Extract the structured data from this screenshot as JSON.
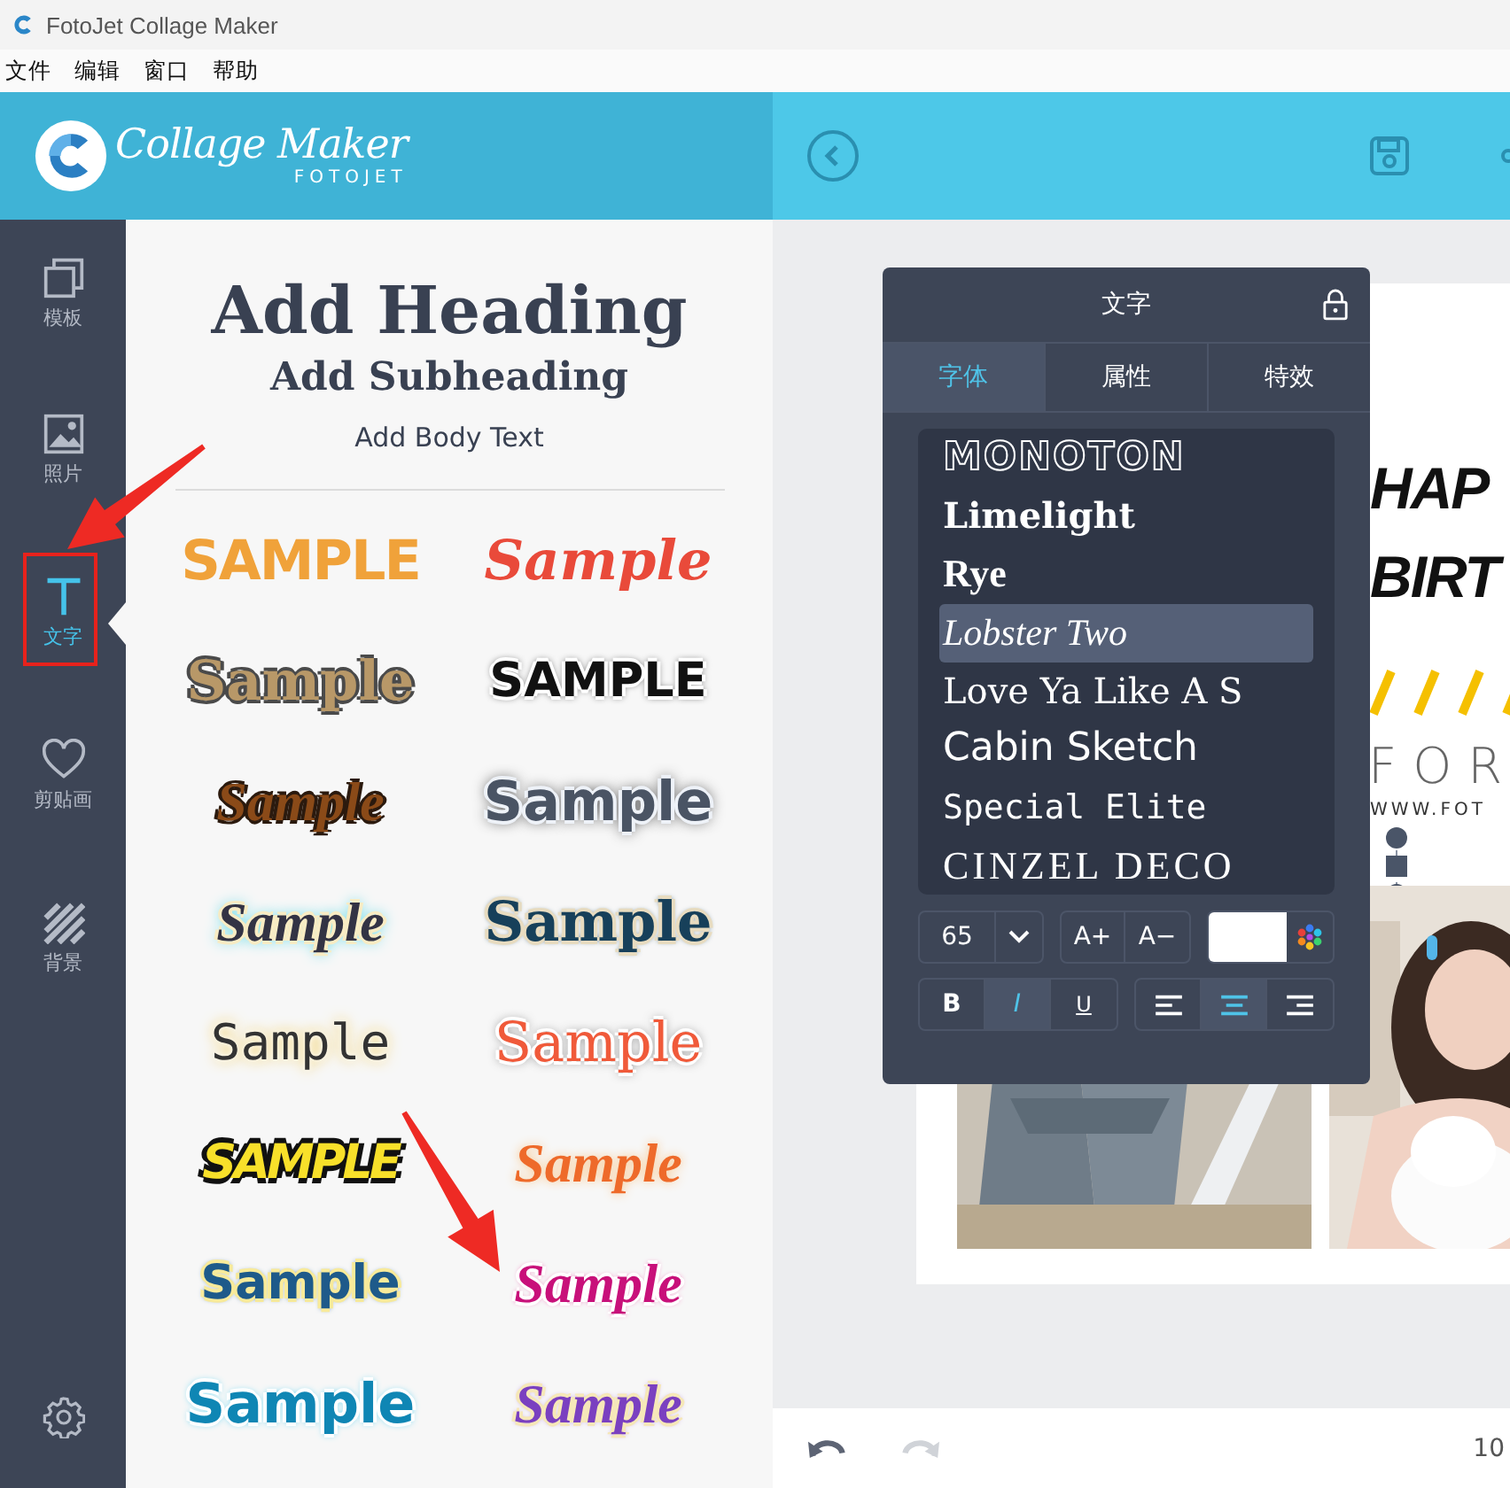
{
  "window": {
    "title": "FotoJet Collage Maker"
  },
  "menu": [
    "文件",
    "编辑",
    "窗口",
    "帮助"
  ],
  "logo": {
    "name": "Collage Maker",
    "brand": "FOTOJET"
  },
  "sidebar": {
    "items": [
      {
        "kind": "template",
        "label": "模板",
        "selected": false
      },
      {
        "label": "照片",
        "selected": false
      },
      {
        "kind": "text",
        "label": "文字",
        "selected": true
      },
      {
        "kind": "clipart",
        "label": "剪贴画",
        "selected": false
      },
      {
        "kind": "background",
        "label": "背景",
        "selected": false
      }
    ]
  },
  "text_panel": {
    "heading": "Add Heading",
    "subheading": "Add Subheading",
    "body": "Add Body Text",
    "samples": [
      {
        "text": "SAMPLE",
        "kind": "grunge"
      },
      {
        "text": "Sample",
        "kind": "brush"
      },
      {
        "text": "Sample",
        "kind": "vintage"
      },
      {
        "text": "SAMPLE",
        "kind": "block"
      },
      {
        "text": "Sample",
        "kind": "retro-script"
      },
      {
        "text": "Sample",
        "kind": "soft-glow"
      },
      {
        "text": "Sample",
        "kind": "neon-script"
      },
      {
        "text": "Sample",
        "kind": "slab"
      },
      {
        "text": "Sample",
        "kind": "typewriter"
      },
      {
        "text": "Sample",
        "kind": "outline-serif"
      },
      {
        "text": "SAMPLE",
        "kind": "comic"
      },
      {
        "text": "Sample",
        "kind": "warm-script"
      },
      {
        "text": "Sample",
        "kind": "rounded"
      },
      {
        "text": "Sample",
        "kind": "pink-script"
      },
      {
        "text": "Sample",
        "kind": "bubble"
      },
      {
        "text": "Sample",
        "kind": "pastel-script"
      }
    ]
  },
  "canvas": {
    "title_lines": [
      "HAP",
      "BIRT"
    ],
    "tagline": "FOR",
    "url": "WWW.FOT"
  },
  "text_editor": {
    "title": "文字",
    "tabs": [
      {
        "label": "字体",
        "selected": true
      },
      {
        "label": "属性",
        "selected": false
      },
      {
        "label": "特效",
        "selected": false
      }
    ],
    "fonts": [
      {
        "name": "MONOTON",
        "selected": false
      },
      {
        "name": "Limelight",
        "selected": false
      },
      {
        "name": "Rye",
        "selected": false
      },
      {
        "name": "Lobster Two",
        "selected": true
      },
      {
        "name": "Love Ya Like A S",
        "selected": false
      },
      {
        "name": "Cabin Sketch",
        "selected": false
      },
      {
        "name": "Special Elite",
        "selected": false
      },
      {
        "name": "CINZEL DECO",
        "selected": false
      }
    ],
    "size": "65",
    "size_up": "A+",
    "size_down": "A−",
    "color": "#ffffff",
    "style_buttons": [
      {
        "kind": "bold",
        "label": "B",
        "selected": false
      },
      {
        "kind": "italic",
        "label": "I",
        "selected": true
      },
      {
        "kind": "underline",
        "label": "U",
        "selected": false
      }
    ],
    "align": [
      {
        "kind": "left",
        "selected": false
      },
      {
        "kind": "center",
        "selected": true
      },
      {
        "kind": "right",
        "selected": false
      }
    ]
  },
  "bottom_bar": {
    "undo": {
      "disabled": false
    },
    "redo": {
      "disabled": true
    },
    "zoom": "10"
  }
}
